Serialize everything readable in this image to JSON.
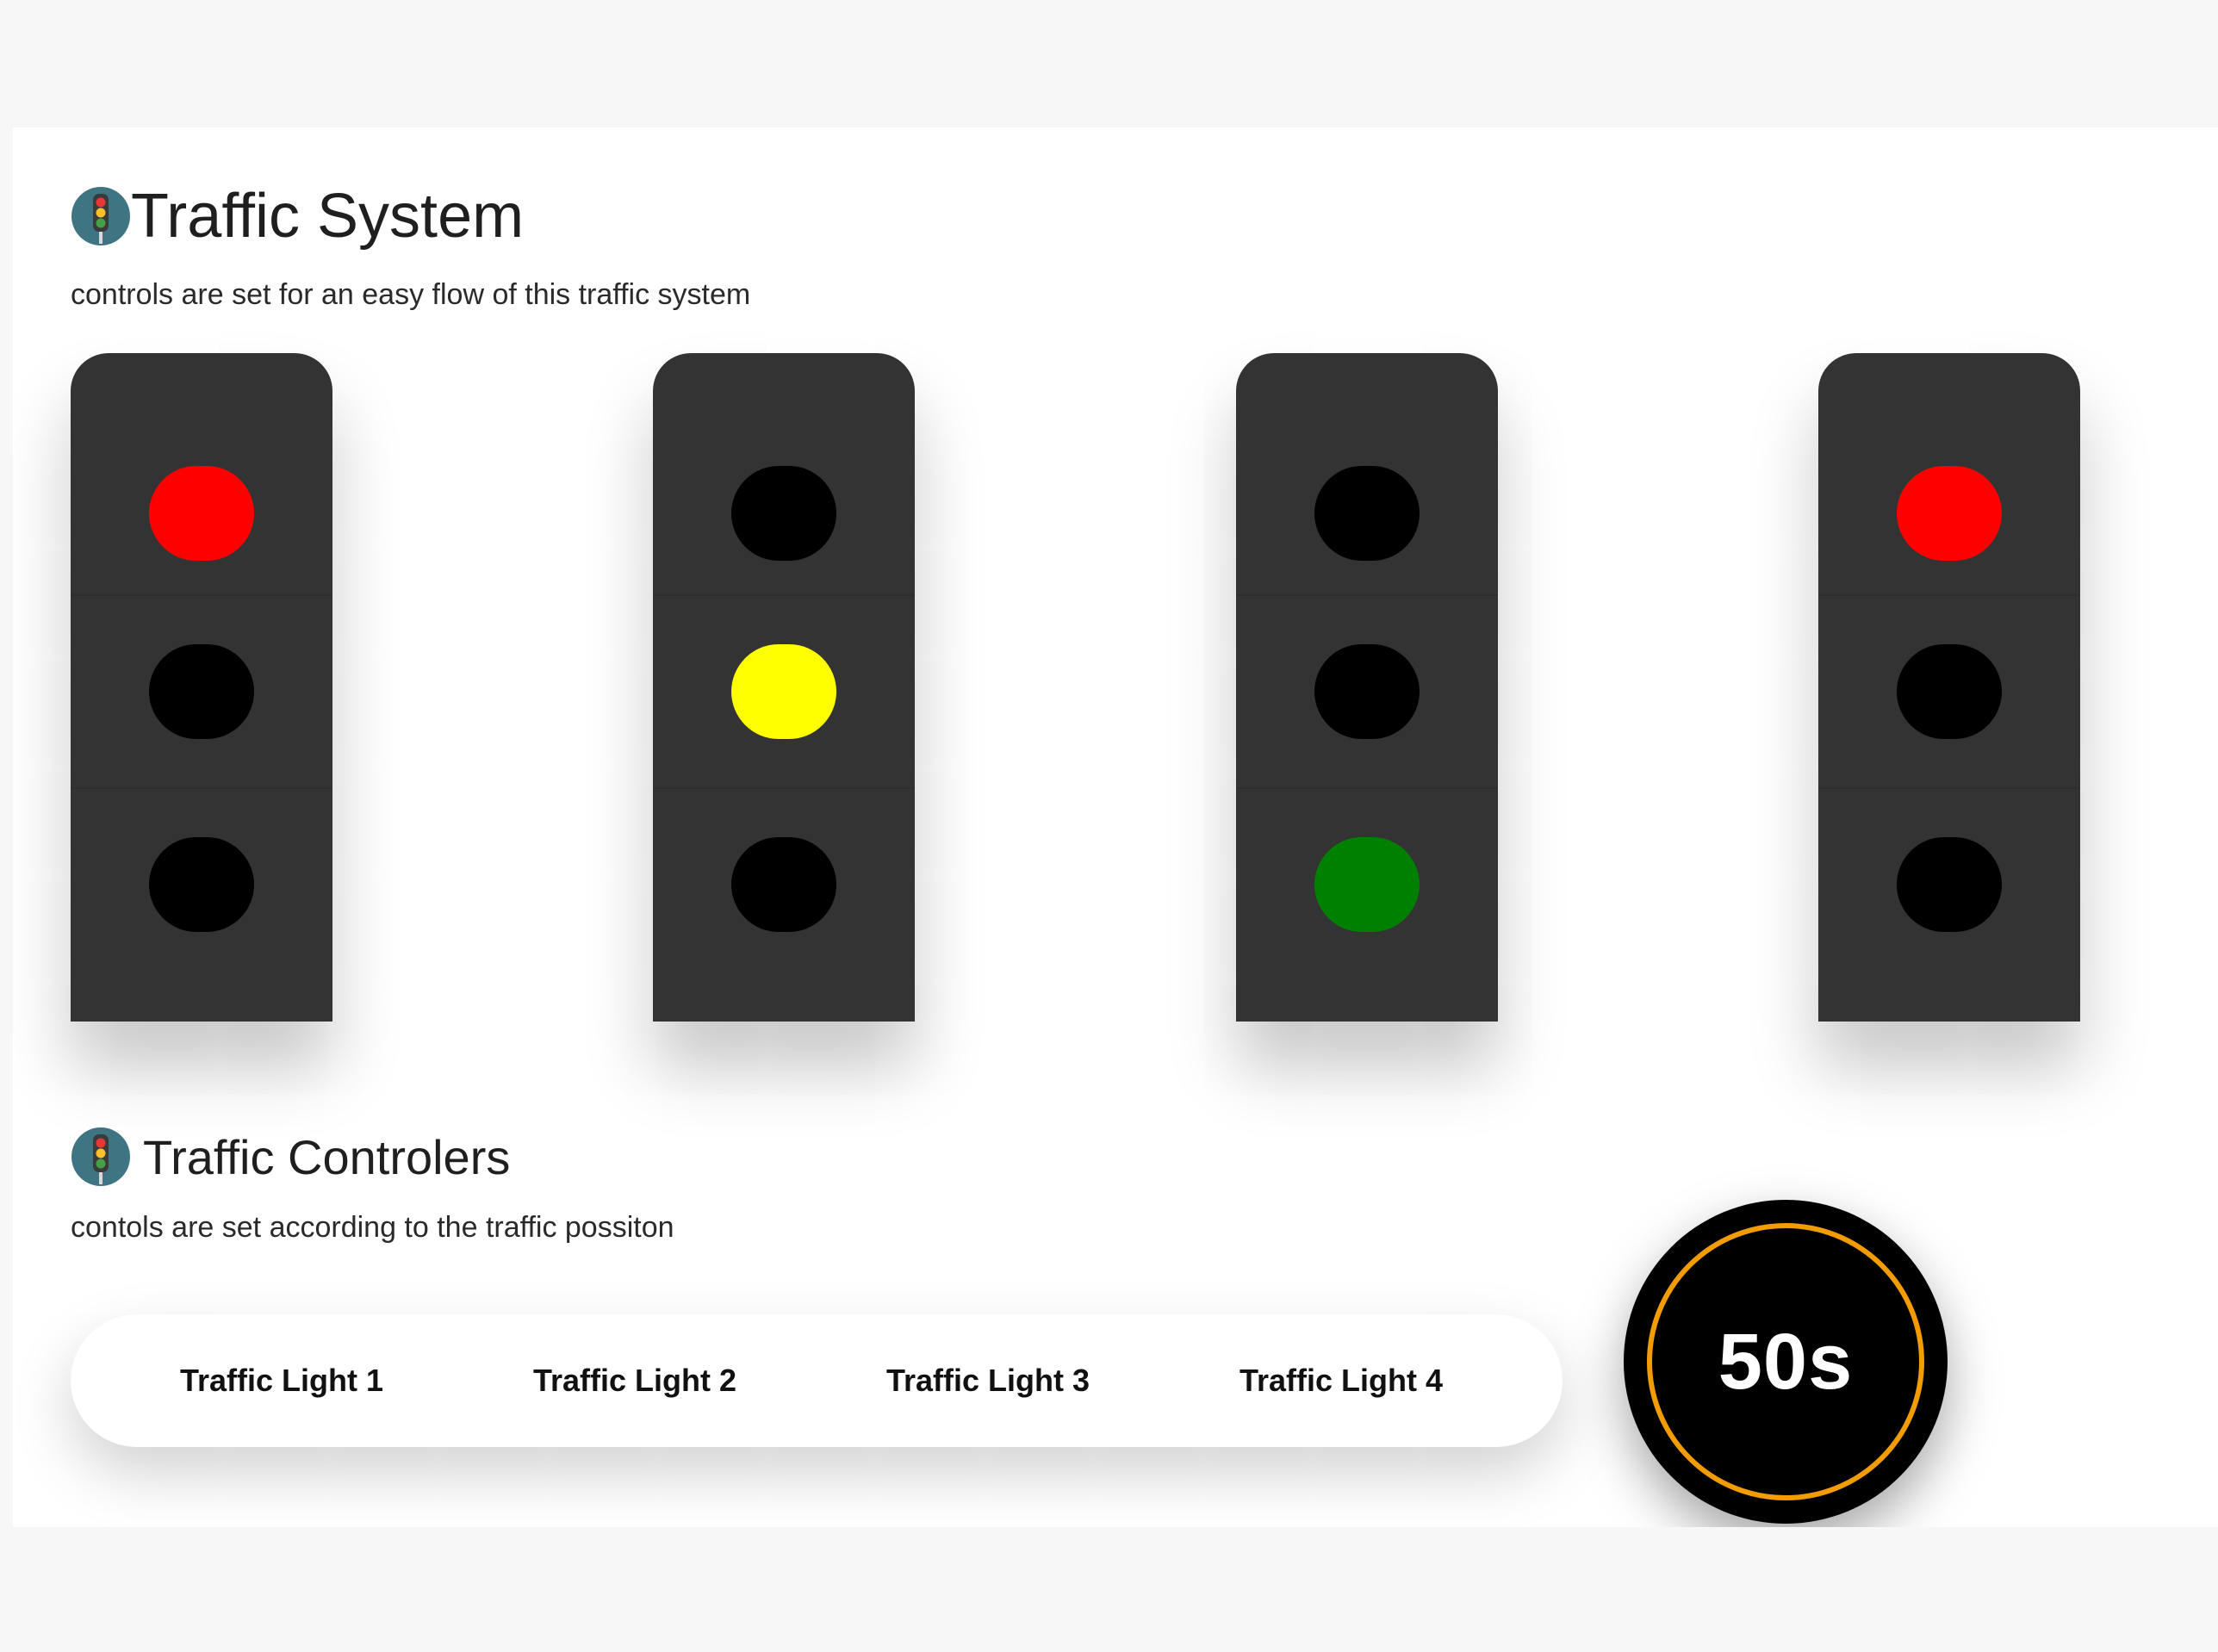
{
  "system": {
    "title": "Traffic System",
    "subtitle": "controls are set for an easy flow of this traffic system",
    "icon": "traffic-light-icon"
  },
  "lights": [
    {
      "active": "red"
    },
    {
      "active": "yellow"
    },
    {
      "active": "green"
    },
    {
      "active": "red"
    }
  ],
  "lamp_colors": {
    "red": "#ff0000",
    "yellow": "#ffff00",
    "green": "#008000",
    "off": "#000000"
  },
  "controllers": {
    "title": "Traffic Controlers",
    "subtitle": "contols are set according to the traffic possiton",
    "icon": "traffic-light-icon",
    "buttons": [
      {
        "label": "Traffic Light 1"
      },
      {
        "label": "Traffic Light 2"
      },
      {
        "label": "Traffic Light 3"
      },
      {
        "label": "Traffic Light 4"
      }
    ]
  },
  "timer": {
    "text": "50s",
    "ring_color": "#f29c00"
  }
}
